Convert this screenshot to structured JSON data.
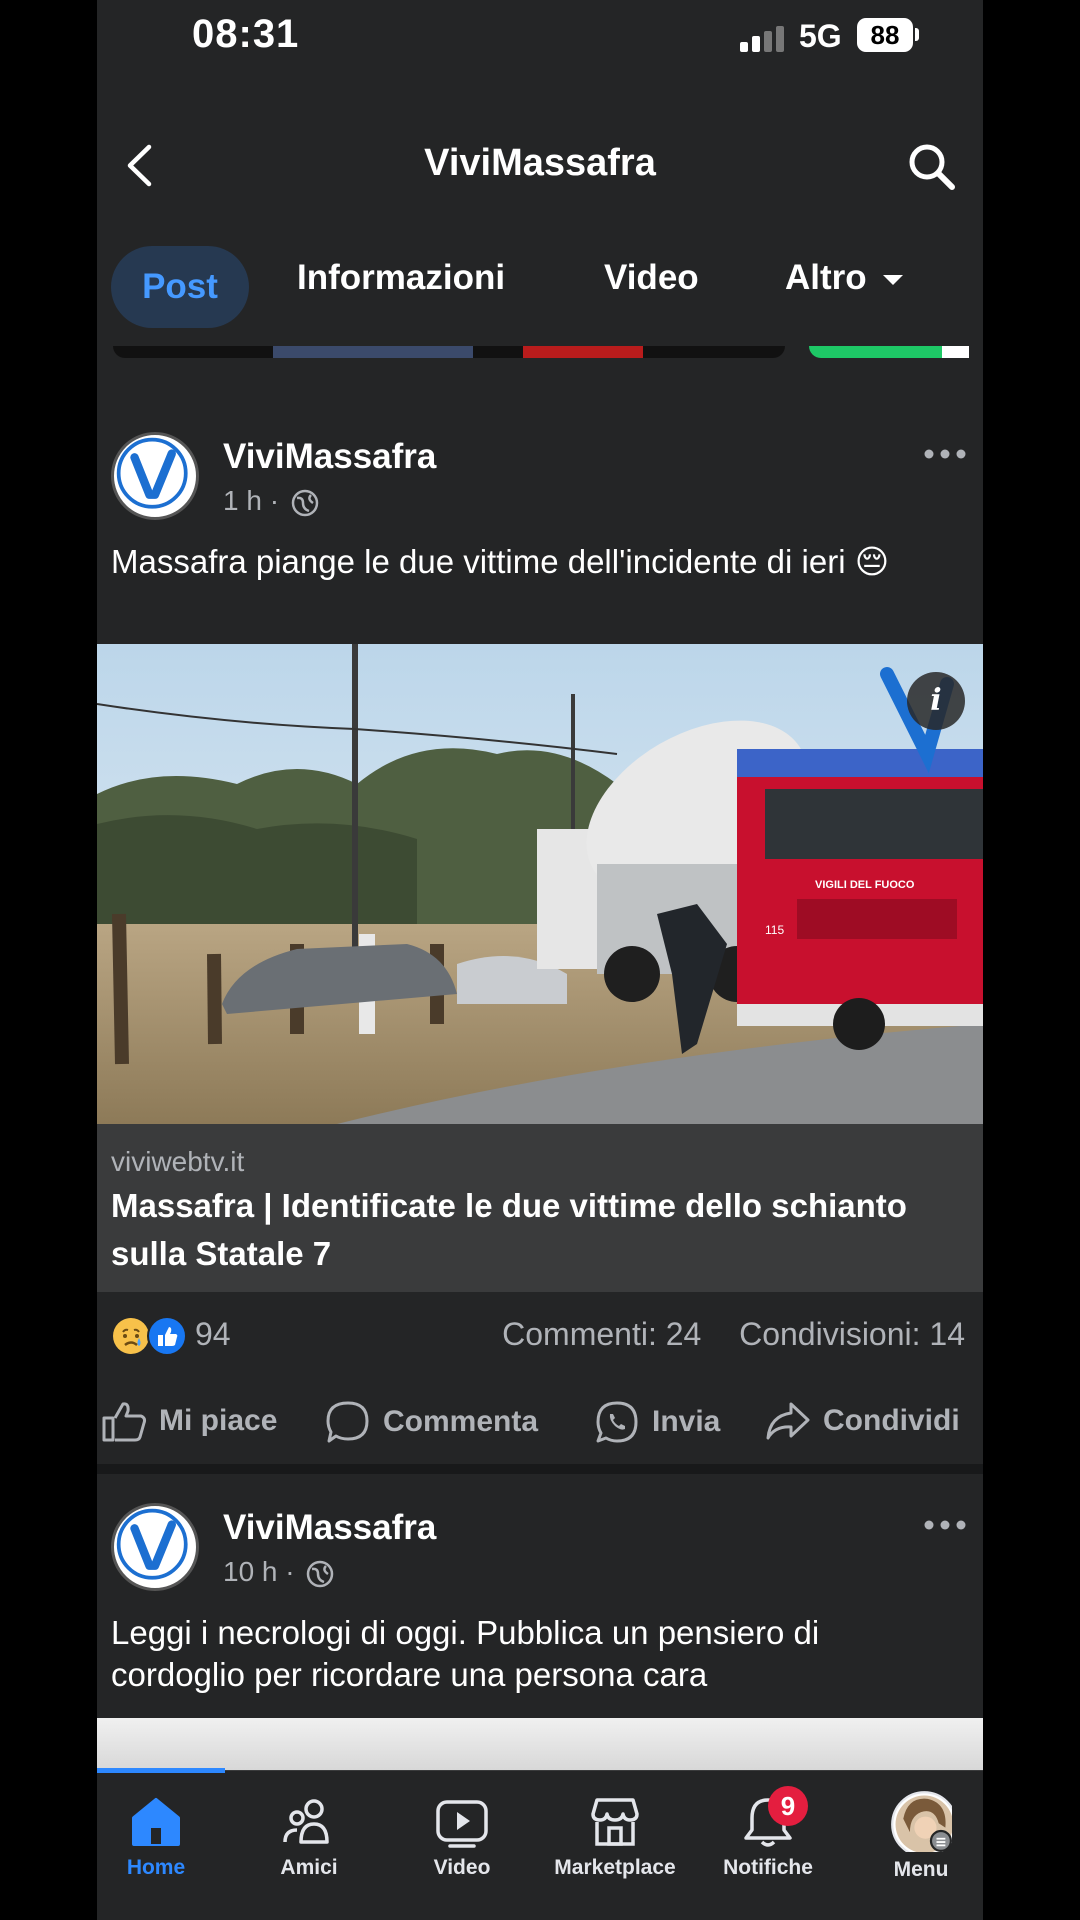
{
  "status_bar": {
    "time": "08:31",
    "network": "5G",
    "battery": "88"
  },
  "header": {
    "title": "ViviMassafra"
  },
  "tabs": [
    {
      "label": "Post",
      "active": true
    },
    {
      "label": "Informazioni"
    },
    {
      "label": "Video"
    },
    {
      "label": "Altro"
    }
  ],
  "posts": [
    {
      "author": "ViviMassafra",
      "time": "1 h ·",
      "text": "Massafra piange le due vittime dell'incidente di ieri 😔",
      "link_domain": "viviwebtv.it",
      "link_title": "Massafra | Identificate le due vittime dello schianto sulla Statale 7",
      "reactions_count": "94",
      "comments": "Commenti: 24",
      "shares": "Condivisioni: 14",
      "actions": {
        "like": "Mi piace",
        "comment": "Commenta",
        "send": "Invia",
        "share": "Condividi"
      }
    },
    {
      "author": "ViviMassafra",
      "time": "10 h ·",
      "text": "Leggi i necrologi di oggi. Pubblica un pensiero di cordoglio per ricordare una persona cara"
    }
  ],
  "image": {
    "truck_text": "VIGILI DEL FUOCO",
    "truck_number": "115"
  },
  "bottom_nav": {
    "items": [
      {
        "label": "Home",
        "icon": "home-icon",
        "active": true
      },
      {
        "label": "Amici",
        "icon": "friends-icon"
      },
      {
        "label": "Video",
        "icon": "video-icon"
      },
      {
        "label": "Marketplace",
        "icon": "marketplace-icon"
      },
      {
        "label": "Notifiche",
        "icon": "bell-icon"
      },
      {
        "label": "Menu",
        "icon": "menu-avatar"
      }
    ],
    "notifications_badge": "9"
  },
  "colors": {
    "accent": "#2d88ff",
    "background": "#242526",
    "badge": "#e41e3f"
  }
}
